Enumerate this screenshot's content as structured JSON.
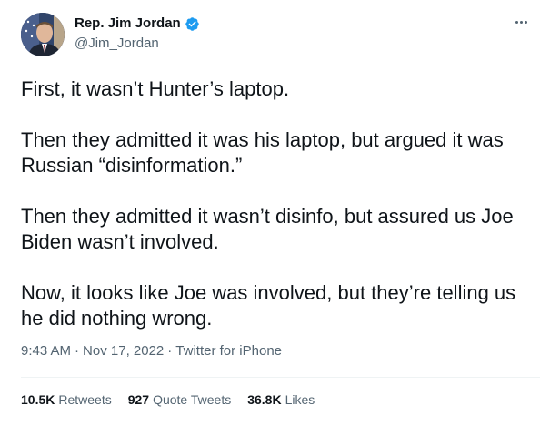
{
  "author": {
    "display_name": "Rep. Jim Jordan",
    "handle": "@Jim_Jordan",
    "verified": true,
    "verified_color": "#1d9bf0"
  },
  "tweet": {
    "paragraphs": [
      "First, it wasn’t Hunter’s laptop.",
      "Then they admitted it was his laptop, but argued it was Russian “disinformation.”",
      "Then they admitted it wasn’t disinfo, but assured us Joe Biden wasn’t involved.",
      "Now, it looks like Joe was involved, but they’re telling us he did nothing wrong."
    ],
    "time": "9:43 AM",
    "separator": "·",
    "date": "Nov 17, 2022",
    "source": "Twitter for iPhone"
  },
  "stats": {
    "retweets_count": "10.5K",
    "retweets_label": "Retweets",
    "quote_count": "927",
    "quote_label": "Quote Tweets",
    "likes_count": "36.8K",
    "likes_label": "Likes"
  },
  "icons": {
    "more": "more-dots-icon",
    "verified": "verified-badge-icon"
  }
}
